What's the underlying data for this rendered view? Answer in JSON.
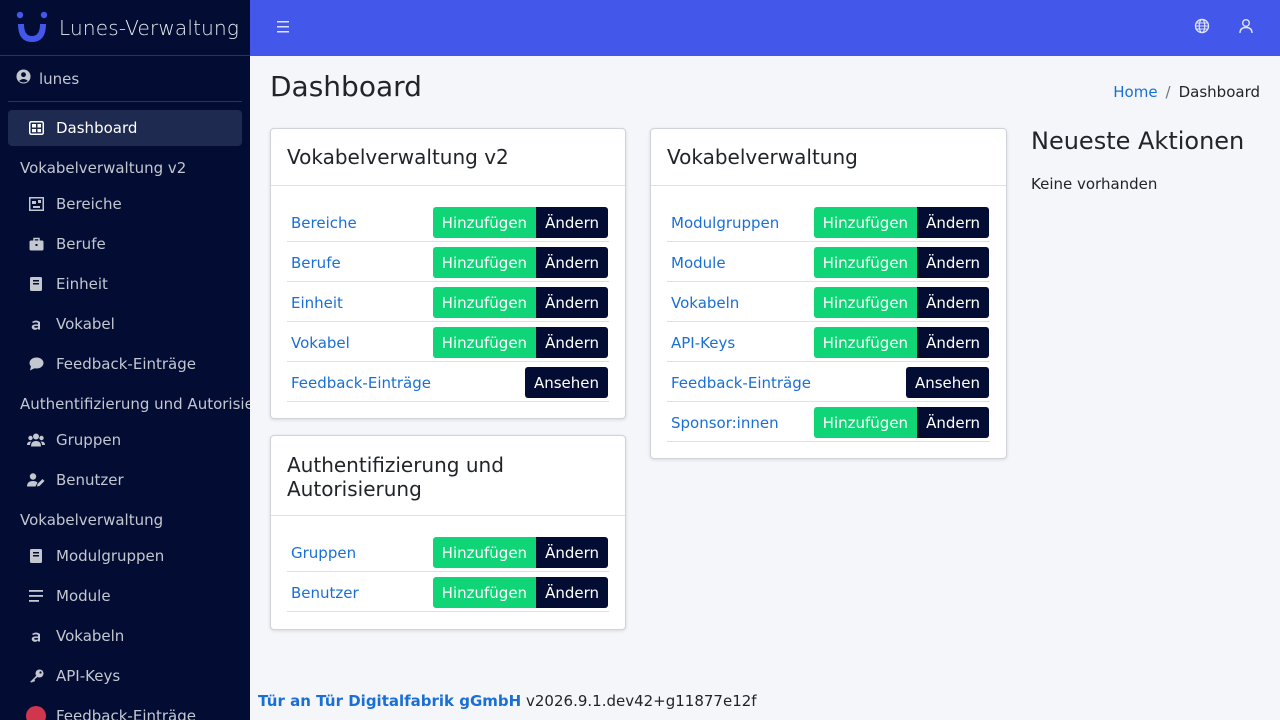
{
  "app": {
    "title": "Lunes-Verwaltung"
  },
  "user": {
    "name": "lunes"
  },
  "sidebar": {
    "dashboard": "Dashboard",
    "section_v2": "Vokabelverwaltung v2",
    "v2_items": [
      "Bereiche",
      "Berufe",
      "Einheit",
      "Vokabel",
      "Feedback-Einträge"
    ],
    "section_auth": "Authentifizierung und Autorisierung",
    "auth_items": [
      "Gruppen",
      "Benutzer"
    ],
    "section_vocab": "Vokabelverwaltung",
    "vocab_items": [
      "Modulgruppen",
      "Module",
      "Vokabeln",
      "API-Keys",
      "Feedback-Einträge"
    ]
  },
  "page": {
    "title": "Dashboard"
  },
  "breadcrumb": {
    "home": "Home",
    "separator": "/",
    "current": "Dashboard"
  },
  "buttons": {
    "add": "Hinzufügen",
    "edit": "Ändern",
    "view": "Ansehen"
  },
  "cards": {
    "v2": {
      "title": "Vokabelverwaltung v2",
      "rows": [
        "Bereiche",
        "Berufe",
        "Einheit",
        "Vokabel",
        "Feedback-Einträge"
      ]
    },
    "auth": {
      "title": "Authentifizierung und Autorisierung",
      "rows": [
        "Gruppen",
        "Benutzer"
      ]
    },
    "vocab": {
      "title": "Vokabelverwaltung",
      "rows": [
        "Modulgruppen",
        "Module",
        "Vokabeln",
        "API-Keys",
        "Feedback-Einträge",
        "Sponsor:innen"
      ]
    }
  },
  "recent": {
    "title": "Neueste Aktionen",
    "empty": "Keine vorhanden"
  },
  "footer": {
    "org": "Tür an Tür Digitalfabrik gGmbH",
    "version": "v2026.9.1.dev42+g11877e12f"
  },
  "colors": {
    "sidebar": "#030c32",
    "topbar": "#4357ea",
    "add": "#0fd576",
    "edit": "#030c32",
    "link": "#1a6fd6"
  }
}
